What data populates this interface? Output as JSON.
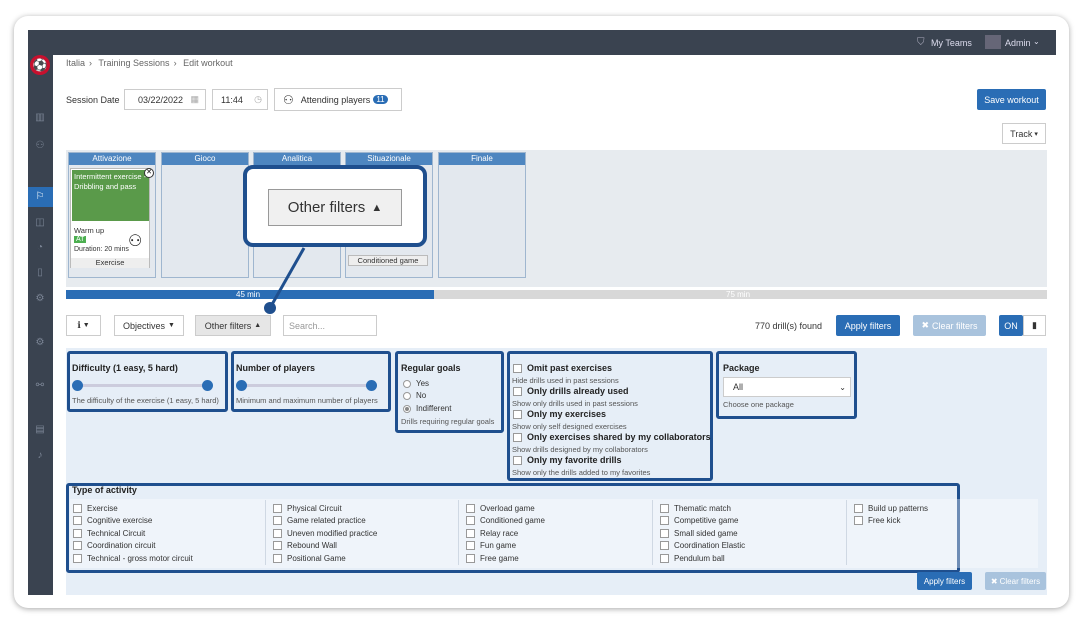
{
  "topbar": {
    "my_teams": "My Teams",
    "admin": "Admin"
  },
  "breadcrumb": [
    "Italia",
    "Training Sessions",
    "Edit workout"
  ],
  "session": {
    "date_label": "Session Date",
    "date_value": "03/22/2022",
    "time_value": "11:44",
    "attending_label": "Attending players",
    "attending_count": "11",
    "save_label": "Save workout",
    "track_label": "Track"
  },
  "board": {
    "columns": [
      "Attivazione",
      "Gioco",
      "Analitica",
      "Situazionale",
      "Finale"
    ],
    "card": {
      "title": "Intermittent exercise - Dribbling and pass",
      "phase": "Warm up",
      "tag": "AT",
      "duration": "Duration: 20 mins",
      "footer": "Exercise"
    },
    "card2_footer": "Conditioned game",
    "progress_left": "45 min",
    "progress_right": "75 min",
    "progress_fraction": 0.375
  },
  "toolbar": {
    "objectives": "Objectives",
    "other_filters": "Other filters",
    "search_placeholder": "Search...",
    "drills_found": "770 drill(s) found",
    "apply": "Apply filters",
    "clear": "Clear filters",
    "on": "ON"
  },
  "callout": {
    "label": "Other filters"
  },
  "filters": {
    "difficulty": {
      "title": "Difficulty (1 easy, 5 hard)",
      "desc": "The difficulty of the exercise (1 easy, 5 hard)"
    },
    "players": {
      "title": "Number of players",
      "desc": "Minimum and maximum number of players"
    },
    "goals": {
      "title": "Regular goals",
      "options": [
        "Yes",
        "No",
        "Indifferent"
      ],
      "selected": "Indifferent",
      "desc": "Drills requiring regular goals"
    },
    "checks": [
      {
        "title": "Omit past exercises",
        "desc": "Hide drills used in past sessions"
      },
      {
        "title": "Only drills already used",
        "desc": "Show only drills used in past sessions"
      },
      {
        "title": "Only my exercises",
        "desc": "Show only self designed exercises"
      },
      {
        "title": "Only exercises shared by my collaborators",
        "desc": "Show drills designed by my collaborators"
      },
      {
        "title": "Only my favorite drills",
        "desc": "Show only the drills added to my favorites"
      }
    ],
    "package": {
      "title": "Package",
      "value": "All",
      "desc": "Choose one package"
    },
    "activity": {
      "title": "Type of activity",
      "columns": [
        [
          "Exercise",
          "Cognitive exercise",
          "Technical Circuit",
          "Coordination circuit",
          "Technical - gross motor circuit"
        ],
        [
          "Physical Circuit",
          "Game related practice",
          "Uneven modified practice",
          "Rebound Wall",
          "Positional Game"
        ],
        [
          "Overload game",
          "Conditioned game",
          "Relay race",
          "Fun game",
          "Free game"
        ],
        [
          "Thematic match",
          "Competitive game",
          "Small sided game",
          "Coordination Elastic",
          "Pendulum ball"
        ],
        [
          "Build up patterns",
          "Free kick"
        ]
      ]
    },
    "bottom_apply": "Apply filters",
    "bottom_clear": "Clear filters"
  }
}
